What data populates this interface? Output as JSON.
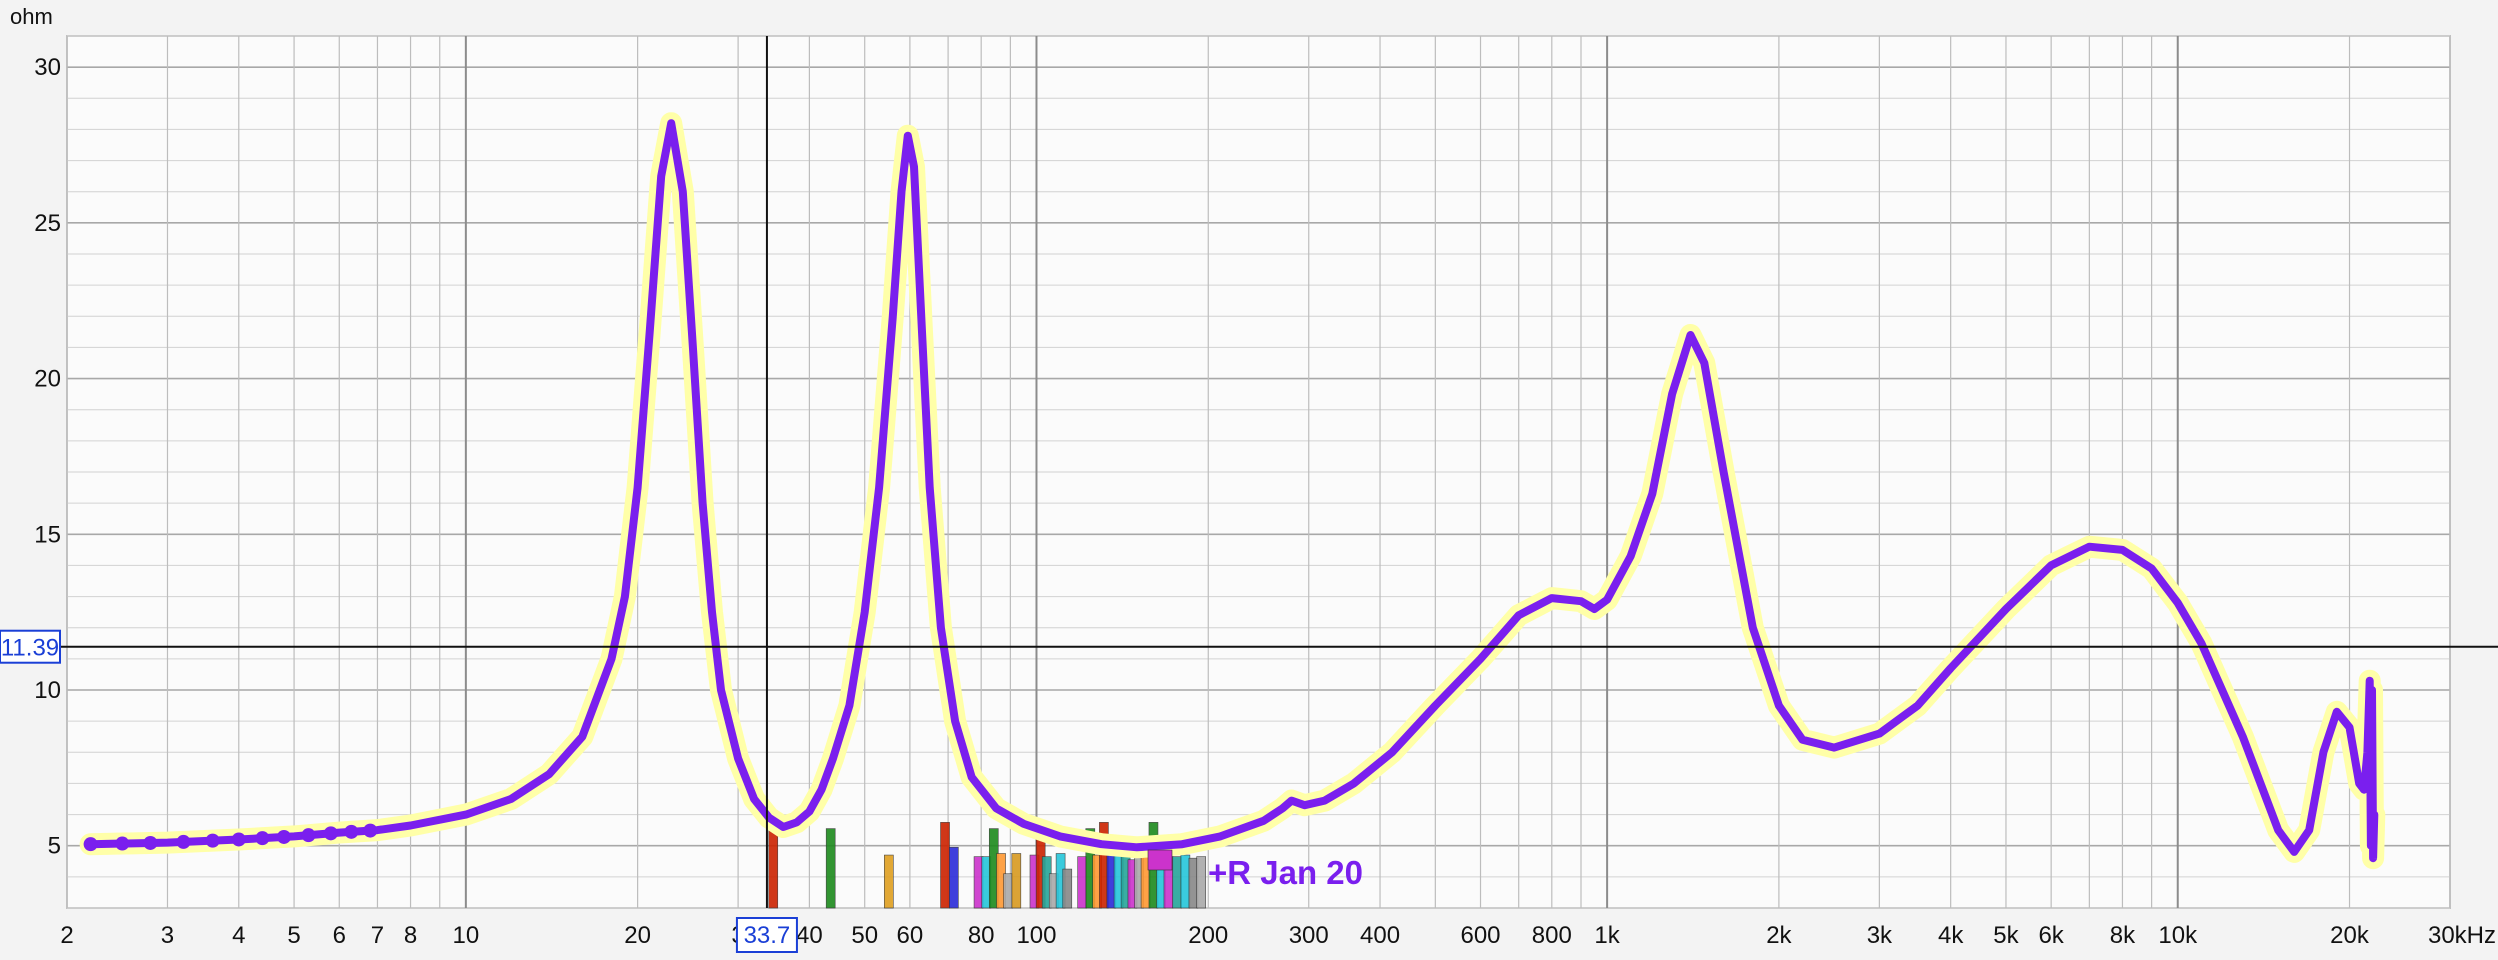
{
  "chart_data": {
    "type": "line",
    "y_unit": "ohm",
    "x_unit": "kHz",
    "x_scale": "log",
    "xlim": [
      2,
      30000
    ],
    "ylim": [
      3,
      31
    ],
    "grid": true,
    "x_ticks": [
      {
        "value": 2,
        "label": "2"
      },
      {
        "value": 3,
        "label": "3"
      },
      {
        "value": 4,
        "label": "4"
      },
      {
        "value": 5,
        "label": "5"
      },
      {
        "value": 6,
        "label": "6"
      },
      {
        "value": 7,
        "label": "7"
      },
      {
        "value": 8,
        "label": "8"
      },
      {
        "value": 10,
        "label": "10"
      },
      {
        "value": 20,
        "label": "20"
      },
      {
        "value": 30,
        "label": "3"
      },
      {
        "value": 40,
        "label": "40"
      },
      {
        "value": 50,
        "label": "50"
      },
      {
        "value": 60,
        "label": "60"
      },
      {
        "value": 80,
        "label": "80"
      },
      {
        "value": 100,
        "label": "100"
      },
      {
        "value": 200,
        "label": "200"
      },
      {
        "value": 300,
        "label": "300"
      },
      {
        "value": 400,
        "label": "400"
      },
      {
        "value": 600,
        "label": "600"
      },
      {
        "value": 800,
        "label": "800"
      },
      {
        "value": 1000,
        "label": "1k"
      },
      {
        "value": 2000,
        "label": "2k"
      },
      {
        "value": 3000,
        "label": "3k"
      },
      {
        "value": 4000,
        "label": "4k"
      },
      {
        "value": 5000,
        "label": "5k"
      },
      {
        "value": 6000,
        "label": "6k"
      },
      {
        "value": 8000,
        "label": "8k"
      },
      {
        "value": 10000,
        "label": "10k"
      },
      {
        "value": 20000,
        "label": "20k"
      },
      {
        "value": 30000,
        "label": "30kHz"
      }
    ],
    "y_ticks": [
      5,
      10,
      15,
      20,
      25,
      30
    ],
    "cursor": {
      "x": 33.7,
      "y": 11.39,
      "x_label": "33.7",
      "y_label": "11.39"
    },
    "series": [
      {
        "name": "+R Jan 20",
        "color": "#7a1fee",
        "halo_color": "#ffffa8",
        "points": [
          [
            2.2,
            5.05
          ],
          [
            3,
            5.1
          ],
          [
            4,
            5.2
          ],
          [
            5,
            5.3
          ],
          [
            6,
            5.42
          ],
          [
            7,
            5.5
          ],
          [
            8,
            5.65
          ],
          [
            10,
            6.0
          ],
          [
            12,
            6.5
          ],
          [
            14,
            7.3
          ],
          [
            16,
            8.5
          ],
          [
            18,
            11.0
          ],
          [
            19,
            13.0
          ],
          [
            20,
            16.5
          ],
          [
            21,
            21.5
          ],
          [
            22,
            26.5
          ],
          [
            22.9,
            28.2
          ],
          [
            24,
            26.0
          ],
          [
            25,
            21.0
          ],
          [
            26,
            16.0
          ],
          [
            27,
            12.5
          ],
          [
            28,
            10.0
          ],
          [
            30,
            7.8
          ],
          [
            32,
            6.5
          ],
          [
            34,
            5.9
          ],
          [
            36,
            5.6
          ],
          [
            38,
            5.75
          ],
          [
            40,
            6.1
          ],
          [
            42,
            6.8
          ],
          [
            44,
            7.8
          ],
          [
            47,
            9.5
          ],
          [
            50,
            12.5
          ],
          [
            53,
            16.5
          ],
          [
            56,
            22.0
          ],
          [
            58,
            26.0
          ],
          [
            59.5,
            27.8
          ],
          [
            61,
            26.8
          ],
          [
            63,
            21.5
          ],
          [
            65,
            16.5
          ],
          [
            68,
            12.0
          ],
          [
            72,
            9.0
          ],
          [
            77,
            7.2
          ],
          [
            85,
            6.2
          ],
          [
            95,
            5.7
          ],
          [
            110,
            5.3
          ],
          [
            130,
            5.05
          ],
          [
            150,
            4.95
          ],
          [
            180,
            5.05
          ],
          [
            210,
            5.3
          ],
          [
            250,
            5.8
          ],
          [
            270,
            6.2
          ],
          [
            280,
            6.45
          ],
          [
            295,
            6.3
          ],
          [
            320,
            6.45
          ],
          [
            360,
            7.0
          ],
          [
            420,
            8.0
          ],
          [
            500,
            9.5
          ],
          [
            600,
            11.0
          ],
          [
            700,
            12.4
          ],
          [
            800,
            12.95
          ],
          [
            900,
            12.85
          ],
          [
            950,
            12.6
          ],
          [
            1000,
            12.9
          ],
          [
            1100,
            14.3
          ],
          [
            1200,
            16.3
          ],
          [
            1300,
            19.5
          ],
          [
            1400,
            21.4
          ],
          [
            1480,
            20.5
          ],
          [
            1600,
            17.0
          ],
          [
            1800,
            12.0
          ],
          [
            2000,
            9.5
          ],
          [
            2200,
            8.4
          ],
          [
            2500,
            8.15
          ],
          [
            3000,
            8.6
          ],
          [
            3500,
            9.5
          ],
          [
            4000,
            10.7
          ],
          [
            5000,
            12.6
          ],
          [
            6000,
            14.0
          ],
          [
            7000,
            14.6
          ],
          [
            8000,
            14.5
          ],
          [
            9000,
            13.9
          ],
          [
            10000,
            12.8
          ],
          [
            11000,
            11.5
          ],
          [
            13000,
            8.5
          ],
          [
            15000,
            5.5
          ],
          [
            16000,
            4.8
          ],
          [
            17000,
            5.5
          ],
          [
            18000,
            8.0
          ],
          [
            19000,
            9.3
          ],
          [
            20000,
            8.8
          ],
          [
            20800,
            7.0
          ],
          [
            21200,
            6.8
          ],
          [
            21500,
            8.0
          ],
          [
            21700,
            10.3
          ],
          [
            21800,
            5.0
          ],
          [
            21900,
            10.0
          ],
          [
            22000,
            4.6
          ],
          [
            22100,
            6.0
          ]
        ],
        "markers_x": [
          2.2,
          2.5,
          2.8,
          3.2,
          3.6,
          4.0,
          4.4,
          4.8,
          5.3,
          5.8,
          6.3,
          6.8
        ]
      }
    ],
    "bars": [
      {
        "x": 34.5,
        "h": 5.75,
        "color": "#cc2200"
      },
      {
        "x": 43.5,
        "h": 5.55,
        "color": "#1d8a1d"
      },
      {
        "x": 55,
        "h": 4.7,
        "color": "#e0a020"
      },
      {
        "x": 69,
        "h": 5.75,
        "color": "#cc2200"
      },
      {
        "x": 71.5,
        "h": 4.95,
        "color": "#2b2bd9"
      },
      {
        "x": 79,
        "h": 4.65,
        "color": "#cc33cc"
      },
      {
        "x": 81.5,
        "h": 4.65,
        "color": "#26c6da"
      },
      {
        "x": 84,
        "h": 5.55,
        "color": "#1d8a1d"
      },
      {
        "x": 86.5,
        "h": 4.75,
        "color": "#ff9933"
      },
      {
        "x": 89,
        "h": 4.1,
        "color": "#aaaaaa"
      },
      {
        "x": 92,
        "h": 4.75,
        "color": "#d89a20"
      },
      {
        "x": 99,
        "h": 4.7,
        "color": "#cc33cc"
      },
      {
        "x": 101.5,
        "h": 5.7,
        "color": "#cc2200"
      },
      {
        "x": 104,
        "h": 4.65,
        "color": "#26a69a"
      },
      {
        "x": 107,
        "h": 4.1,
        "color": "#aaaaaa"
      },
      {
        "x": 110,
        "h": 4.75,
        "color": "#26c6da"
      },
      {
        "x": 113,
        "h": 4.25,
        "color": "#888888"
      },
      {
        "x": 120,
        "h": 4.65,
        "color": "#cc33cc"
      },
      {
        "x": 124,
        "h": 5.55,
        "color": "#1d8a1d"
      },
      {
        "x": 127.5,
        "h": 4.7,
        "color": "#ff9933"
      },
      {
        "x": 131,
        "h": 5.75,
        "color": "#cc2200"
      },
      {
        "x": 135,
        "h": 5.0,
        "color": "#2b2bd9"
      },
      {
        "x": 139,
        "h": 4.7,
        "color": "#26c6da"
      },
      {
        "x": 143,
        "h": 4.65,
        "color": "#26a69a"
      },
      {
        "x": 147,
        "h": 4.55,
        "color": "#cc33cc"
      },
      {
        "x": 151,
        "h": 4.65,
        "color": "#aaaaaa"
      },
      {
        "x": 155,
        "h": 4.7,
        "color": "#ff9933"
      },
      {
        "x": 160,
        "h": 5.75,
        "color": "#1d8a1d"
      },
      {
        "x": 165,
        "h": 4.7,
        "color": "#26c6da"
      },
      {
        "x": 170,
        "h": 4.65,
        "color": "#cc33cc"
      },
      {
        "x": 176,
        "h": 4.65,
        "color": "#26a69a"
      },
      {
        "x": 182,
        "h": 4.7,
        "color": "#26c6da"
      },
      {
        "x": 188,
        "h": 4.6,
        "color": "#888888"
      },
      {
        "x": 194,
        "h": 4.65,
        "color": "#aaaaaa"
      }
    ]
  }
}
